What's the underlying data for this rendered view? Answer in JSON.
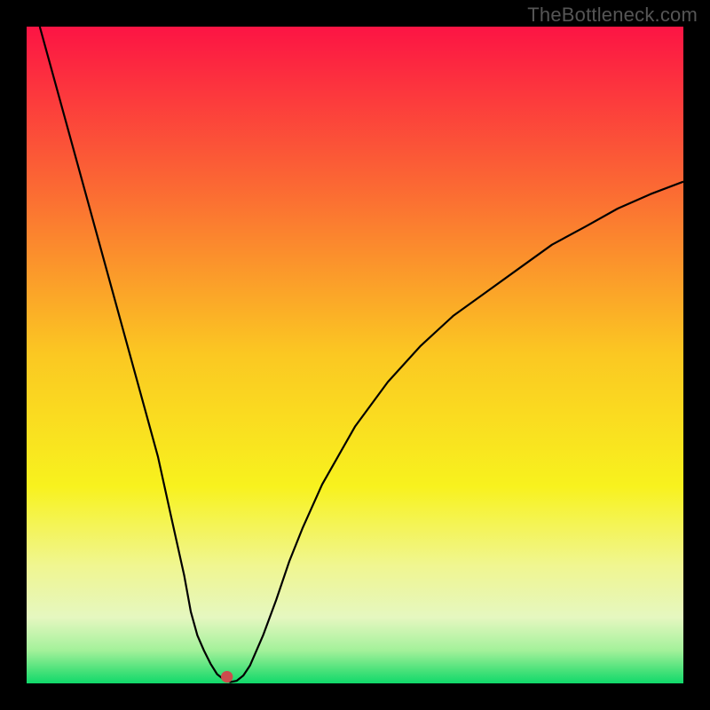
{
  "watermark": "TheBottleneck.com",
  "chart_data": {
    "type": "line",
    "title": "",
    "xlabel": "",
    "ylabel": "",
    "xlim": [
      0,
      100
    ],
    "ylim": [
      0,
      100
    ],
    "grid": false,
    "legend": false,
    "x": [
      2,
      5,
      10,
      15,
      18,
      20,
      22,
      24,
      25,
      26,
      27,
      28,
      29,
      30,
      31,
      32,
      33,
      34,
      36,
      38,
      40,
      42,
      45,
      50,
      55,
      60,
      65,
      70,
      75,
      80,
      85,
      90,
      95,
      100
    ],
    "values": [
      100,
      89.1,
      70.9,
      52.7,
      41.8,
      34.5,
      25.4,
      16.4,
      10.9,
      7.3,
      5.0,
      3.0,
      1.4,
      0.6,
      0.2,
      0.4,
      1.2,
      2.7,
      7.3,
      12.7,
      18.6,
      23.6,
      30.3,
      39.1,
      45.9,
      51.4,
      56.0,
      59.6,
      63.2,
      66.8,
      69.5,
      72.3,
      74.5,
      76.4
    ],
    "marker": {
      "x": 30.5,
      "y": 1.0,
      "color": "#cc4d4d"
    },
    "background_gradient": {
      "stops": [
        {
          "pos": 0.0,
          "color": "#fc1444"
        },
        {
          "pos": 0.25,
          "color": "#fb6b33"
        },
        {
          "pos": 0.5,
          "color": "#fbc822"
        },
        {
          "pos": 0.7,
          "color": "#f8f21e"
        },
        {
          "pos": 0.82,
          "color": "#f0f690"
        },
        {
          "pos": 0.9,
          "color": "#e5f7c0"
        },
        {
          "pos": 0.95,
          "color": "#a3f19a"
        },
        {
          "pos": 0.98,
          "color": "#4ae27a"
        },
        {
          "pos": 1.0,
          "color": "#10d96b"
        }
      ]
    }
  }
}
